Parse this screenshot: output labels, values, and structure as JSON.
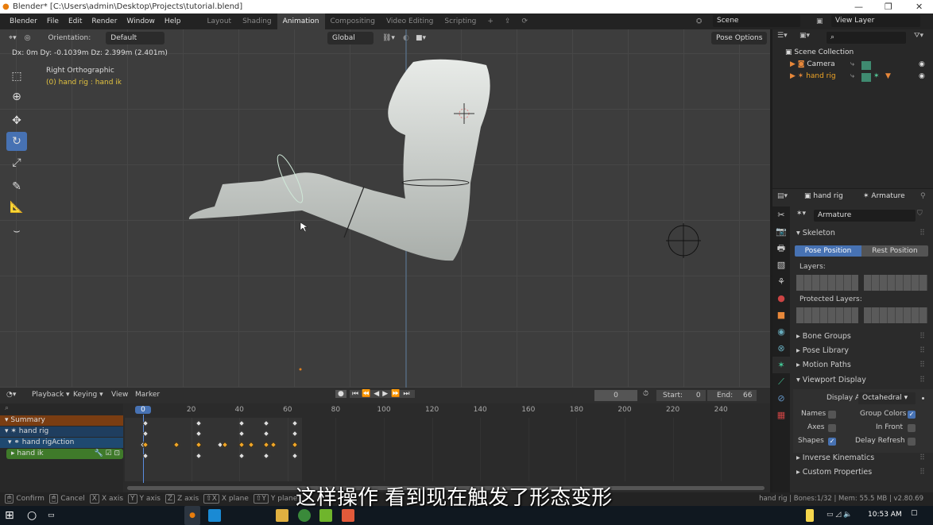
{
  "window": {
    "title": "Blender* [C:\\Users\\admin\\Desktop\\Projects\\tutorial.blend]",
    "controls": [
      "—",
      "❐",
      "✕"
    ]
  },
  "menu": {
    "items": [
      "Blender",
      "File",
      "Edit",
      "Render",
      "Window",
      "Help"
    ],
    "workspaces": [
      "Layout",
      "Shading",
      "Animation",
      "Compositing",
      "Video Editing",
      "Scripting"
    ],
    "active_workspace": "Animation",
    "scene": "Scene",
    "view_layer": "View Layer"
  },
  "viewport": {
    "orientation_label": "Orientation:",
    "orientation_value": "Default",
    "transform_space": "Global",
    "pose_options": "Pose Options",
    "transform_readout": "Dx: 0m  Dy: -0.1039m  Dz: 2.399m (2.401m)",
    "view_name": "Right Orthographic",
    "active_object": "(0) hand rig : hand ik",
    "tools": [
      "select-box",
      "cursor",
      "move",
      "rotate",
      "scale",
      "annotate",
      "measure",
      "bone-tool"
    ],
    "active_tool": "rotate"
  },
  "outliner": {
    "root": "Scene Collection",
    "items": [
      {
        "name": "Camera",
        "color": "#dddddd"
      },
      {
        "name": "hand rig",
        "color": "#f0a526"
      }
    ]
  },
  "properties": {
    "object": "hand rig",
    "data": "Armature",
    "datablock": "Armature",
    "skeleton": {
      "title": "Skeleton",
      "pose_position": "Pose Position",
      "rest_position": "Rest Position",
      "active": "Pose Position",
      "layers_label": "Layers:",
      "protected_label": "Protected Layers:"
    },
    "collapsed_sections": [
      "Bone Groups",
      "Pose Library",
      "Motion Paths"
    ],
    "viewport_display": {
      "title": "Viewport Display",
      "display_as_label": "Display As",
      "display_as": "Octahedral",
      "options": [
        {
          "label": "Names",
          "checked": false
        },
        {
          "label": "Group Colors",
          "checked": true
        },
        {
          "label": "Axes",
          "checked": false
        },
        {
          "label": "In Front",
          "checked": false
        },
        {
          "label": "Shapes",
          "checked": true
        },
        {
          "label": "Delay Refresh",
          "checked": false
        }
      ]
    },
    "more_sections": [
      "Inverse Kinematics",
      "Custom Properties"
    ]
  },
  "timeline": {
    "menus": [
      "Playback",
      "Keying",
      "View",
      "Marker"
    ],
    "current_frame": "0",
    "start_label": "Start:",
    "start": "0",
    "end_label": "End:",
    "end": "66",
    "ticks": [
      "0",
      "20",
      "40",
      "60",
      "80",
      "100",
      "120",
      "140",
      "160",
      "180",
      "200",
      "220",
      "240"
    ],
    "channels": [
      {
        "name": "Summary",
        "color": "#7a3d12"
      },
      {
        "name": "hand rig",
        "color": "#1f3e5f"
      },
      {
        "name": "hand rigAction",
        "color": "#1f4970"
      },
      {
        "name": "hand ik",
        "color": "#3f7a2a"
      }
    ],
    "keyframes": {
      "summary": [
        1,
        23,
        41,
        51,
        63
      ],
      "hand_rig": [
        1,
        23,
        41,
        51,
        63
      ],
      "action": [
        0,
        1,
        14,
        23,
        32,
        34,
        41,
        45,
        51,
        54,
        63
      ],
      "hand_ik": [
        1,
        23,
        41,
        51,
        63
      ]
    },
    "selected_action_keys": [
      1,
      14,
      23,
      34,
      41,
      45,
      51,
      54,
      63
    ]
  },
  "statusbar": {
    "hints": [
      [
        "",
        "Confirm"
      ],
      [
        "",
        "Cancel"
      ],
      [
        "X",
        "X axis"
      ],
      [
        "Y",
        "Y axis"
      ],
      [
        "Z",
        "Z axis"
      ],
      [
        "⇧X",
        "X plane"
      ],
      [
        "⇧Y",
        "Y plane"
      ]
    ],
    "info": "hand rig | Bones:1/32 | Mem: 55.5 MB | v2.80.69"
  },
  "subtitle": "这样操作 看到现在触发了形态变形",
  "taskbar": {
    "time": "10:53 AM"
  }
}
